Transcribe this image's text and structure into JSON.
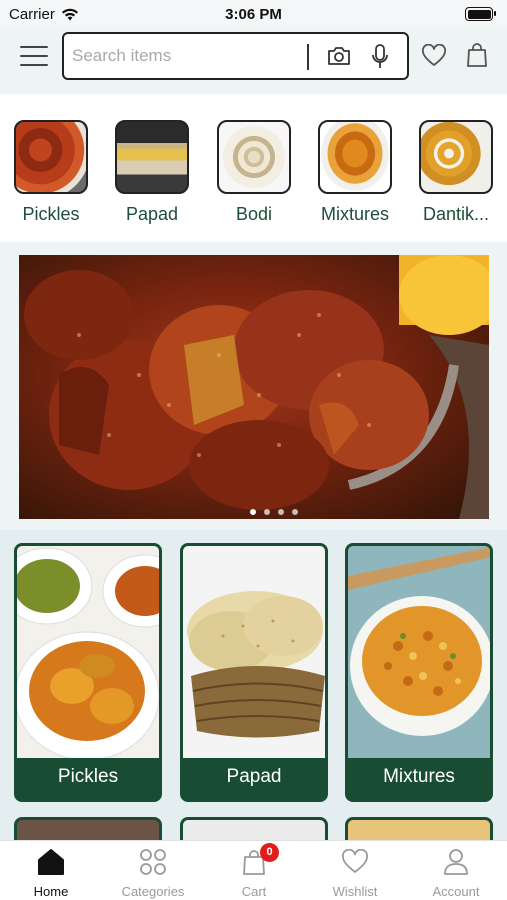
{
  "status_bar": {
    "carrier": "Carrier",
    "time": "3:06 PM"
  },
  "search": {
    "placeholder": "Search items",
    "value": ""
  },
  "categories": [
    {
      "label": "Pickles"
    },
    {
      "label": "Papad"
    },
    {
      "label": "Bodi"
    },
    {
      "label": "Mixtures"
    },
    {
      "label": "Dantik..."
    }
  ],
  "banner": {
    "slide_count": 4,
    "active_slide": 1
  },
  "products": [
    {
      "label": "Pickles"
    },
    {
      "label": "Papad"
    },
    {
      "label": "Mixtures"
    }
  ],
  "bottom_nav": {
    "home": "Home",
    "categories": "Categories",
    "cart": "Cart",
    "cart_count": "0",
    "wishlist": "Wishlist",
    "account": "Account"
  },
  "colors": {
    "brand_green": "#194d33",
    "label_green": "#1d4e37",
    "badge_red": "#e21b1b"
  }
}
